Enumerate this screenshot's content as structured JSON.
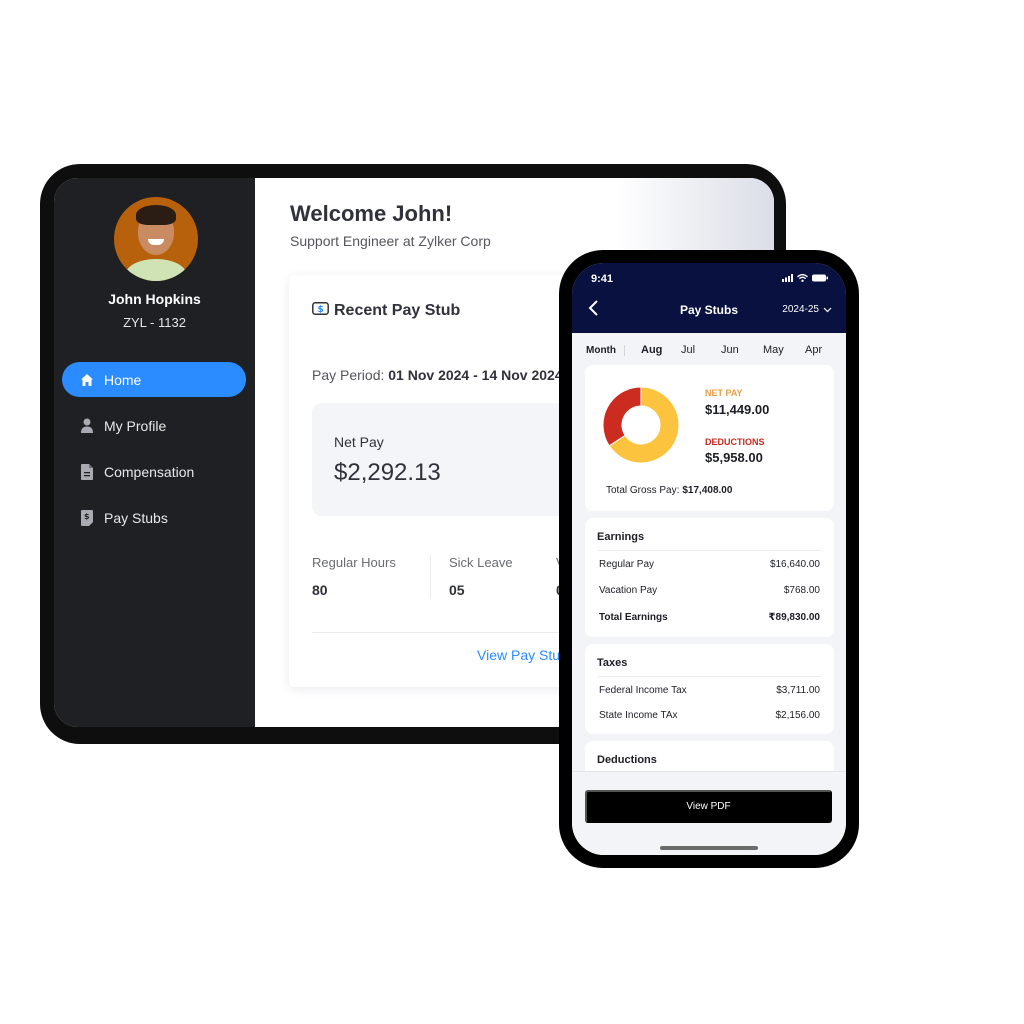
{
  "tablet": {
    "profile": {
      "name": "John Hopkins",
      "employee_id": "ZYL - 1132"
    },
    "nav": [
      {
        "label": "Home",
        "icon": "home-icon",
        "active": true
      },
      {
        "label": "My Profile",
        "icon": "user-icon",
        "active": false
      },
      {
        "label": "Compensation",
        "icon": "document-icon",
        "active": false
      },
      {
        "label": "Pay Stubs",
        "icon": "paystub-icon",
        "active": false
      }
    ],
    "welcome": "Welcome John!",
    "subtitle": "Support Engineer at Zylker Corp",
    "card": {
      "title": "Recent Pay Stub",
      "title_icon": "dollar-bill-icon",
      "period_label": "Pay Period:",
      "period_value": "01 Nov 2024 - 14 Nov 2024",
      "net_pay_label": "Net Pay",
      "net_pay_value": "$2,292.13",
      "stats": [
        {
          "label": "Regular Hours",
          "value": "80"
        },
        {
          "label": "Sick Leave",
          "value": "05"
        },
        {
          "label": "Vacati",
          "value": "0"
        }
      ],
      "link": "View Pay Stu"
    },
    "colors": {
      "accent": "#2a8cff",
      "sidebar": "#1e2024"
    }
  },
  "phone": {
    "status_time": "9:41",
    "title": "Pay Stubs",
    "year": "2024-25",
    "month_label": "Month",
    "months": [
      {
        "label": "Aug",
        "selected": true
      },
      {
        "label": "Jul",
        "selected": false
      },
      {
        "label": "Jun",
        "selected": false
      },
      {
        "label": "May",
        "selected": false
      },
      {
        "label": "Apr",
        "selected": false
      }
    ],
    "summary": {
      "net_pay_label": "NET PAY",
      "net_pay_value": "$11,449.00",
      "deductions_label": "DEDUCTIONS",
      "deductions_value": "$5,958.00",
      "gross_label": "Total Gross Pay:",
      "gross_value": "$17,408.00",
      "colors": {
        "net_pay": "#fcc43e",
        "deductions": "#cc2b1f"
      }
    },
    "earnings": {
      "title": "Earnings",
      "rows": [
        {
          "label": "Regular Pay",
          "value": "$16,640.00"
        },
        {
          "label": "Vacation Pay",
          "value": "$768.00"
        }
      ],
      "total_label": "Total Earnings",
      "total_value": "₹89,830.00"
    },
    "taxes": {
      "title": "Taxes",
      "rows": [
        {
          "label": "Federal Income Tax",
          "value": "$3,711.00"
        },
        {
          "label": "State Income TAx",
          "value": "$2,156.00"
        }
      ]
    },
    "deductions": {
      "title": "Deductions"
    },
    "view_pdf": "View PDF",
    "colors": {
      "header": "#08113f"
    }
  },
  "chart_data": {
    "type": "pie",
    "categories": [
      "Net Pay",
      "Deductions"
    ],
    "values": [
      11449,
      5958
    ],
    "title": "",
    "donut": true
  }
}
